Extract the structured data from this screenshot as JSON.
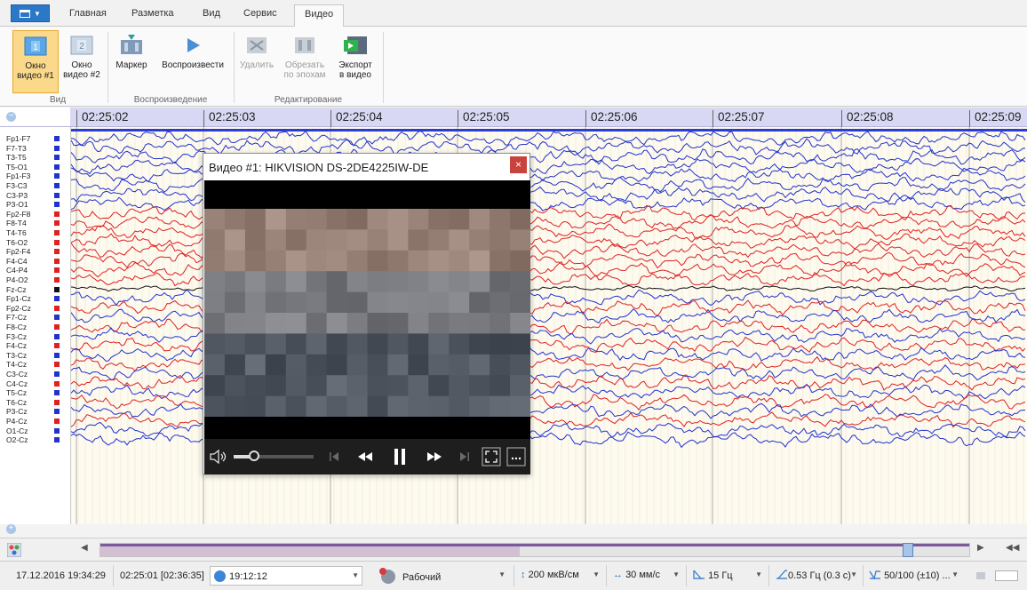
{
  "tabs": [
    "Главная",
    "Разметка",
    "Вид",
    "Сервис",
    "Видео"
  ],
  "active_tab": "Видео",
  "ribbon": {
    "buttons": {
      "video1": {
        "line1": "Окно",
        "line2": "видео #1",
        "badge": "1"
      },
      "video2": {
        "line1": "Окно",
        "line2": "видео #2",
        "badge": "2"
      },
      "marker": {
        "line1": "Маркер"
      },
      "play": {
        "line1": "Воспроизвести"
      },
      "delete": {
        "line1": "Удалить"
      },
      "trim": {
        "line1": "Обрезать",
        "line2": "по эпохам"
      },
      "export": {
        "line1": "Экспорт",
        "line2": "в видео"
      }
    },
    "groups": {
      "view": "Вид",
      "playback": "Воспроизведение",
      "editing": "Редактирование"
    }
  },
  "ruler": {
    "ticks": [
      "02:25:02",
      "02:25:03",
      "02:25:04",
      "02:25:05",
      "02:25:06",
      "02:25:07",
      "02:25:08",
      "02:25:09"
    ]
  },
  "channels": [
    {
      "name": "Fp1-F7",
      "color": "#2233cc"
    },
    {
      "name": "F7-T3",
      "color": "#2233cc"
    },
    {
      "name": "T3-T5",
      "color": "#2233cc"
    },
    {
      "name": "T5-O1",
      "color": "#2233cc"
    },
    {
      "name": "Fp1-F3",
      "color": "#2233cc"
    },
    {
      "name": "F3-C3",
      "color": "#2233cc"
    },
    {
      "name": "C3-P3",
      "color": "#2233cc"
    },
    {
      "name": "P3-O1",
      "color": "#2233cc"
    },
    {
      "name": "Fp2-F8",
      "color": "#dd2222"
    },
    {
      "name": "F8-T4",
      "color": "#dd2222"
    },
    {
      "name": "T4-T6",
      "color": "#dd2222"
    },
    {
      "name": "T6-O2",
      "color": "#dd2222"
    },
    {
      "name": "Fp2-F4",
      "color": "#dd2222"
    },
    {
      "name": "F4-C4",
      "color": "#dd2222"
    },
    {
      "name": "C4-P4",
      "color": "#dd2222"
    },
    {
      "name": "P4-O2",
      "color": "#dd2222"
    },
    {
      "name": "Fz-Cz",
      "color": "#111111"
    },
    {
      "name": "Fp1-Cz",
      "color": "#2233cc"
    },
    {
      "name": "Fp2-Cz",
      "color": "#dd2222"
    },
    {
      "name": "F7-Cz",
      "color": "#2233cc"
    },
    {
      "name": "F8-Cz",
      "color": "#dd2222"
    },
    {
      "name": "F3-Cz",
      "color": "#2233cc"
    },
    {
      "name": "F4-Cz",
      "color": "#dd2222"
    },
    {
      "name": "T3-Cz",
      "color": "#2233cc"
    },
    {
      "name": "T4-Cz",
      "color": "#dd2222"
    },
    {
      "name": "C3-Cz",
      "color": "#2233cc"
    },
    {
      "name": "C4-Cz",
      "color": "#dd2222"
    },
    {
      "name": "T5-Cz",
      "color": "#2233cc"
    },
    {
      "name": "T6-Cz",
      "color": "#dd2222"
    },
    {
      "name": "P3-Cz",
      "color": "#2233cc"
    },
    {
      "name": "P4-Cz",
      "color": "#dd2222"
    },
    {
      "name": "O1-Cz",
      "color": "#2233cc"
    },
    {
      "name": "O2-Cz",
      "color": "#2233cc"
    }
  ],
  "video_window": {
    "title": "Видео #1: HIKVISION DS-2DE4225IW-DE",
    "close": "×",
    "volume": 0.25
  },
  "status": {
    "datetime": "17.12.2016 19:34:29",
    "position": "02:25:01  [02:36:35]",
    "clock": "19:12:12",
    "mode": "Рабочий",
    "sensitivity": "200 мкВ/см",
    "speed": "30 мм/с",
    "lowpass": "15 Гц",
    "highpass": "0.53 Гц (0.3 с)",
    "notch": "50/100 (±10) ..."
  },
  "colors": {
    "accent": "#2b78c8",
    "blue_trace": "#2233cc",
    "red_trace": "#dd2222",
    "ruler_band": "#d8d8f4",
    "selected": "#fbd98a"
  }
}
